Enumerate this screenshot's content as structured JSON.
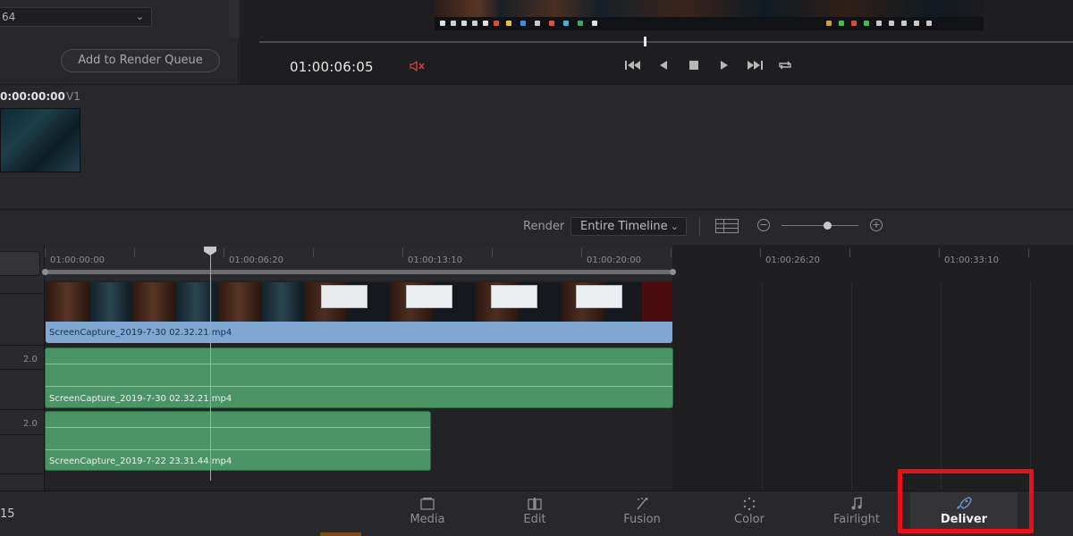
{
  "settings": {
    "codec_value": "64",
    "add_to_render_queue": "Add to Render Queue"
  },
  "viewer": {
    "timecode": "01:00:06:05",
    "muted": true
  },
  "clip": {
    "timecode": "0:00:00:00",
    "track": "V1"
  },
  "render_bar": {
    "label": "Render",
    "selected": "Entire Timeline"
  },
  "timeline": {
    "ruler": [
      "01:00:00:00",
      "01:00:06:20",
      "01:00:13:10",
      "01:00:20:00",
      "01:00:26:20",
      "01:00:33:10"
    ],
    "levels": [
      "2.0",
      "2.0"
    ],
    "video_clip": "ScreenCapture_2019-7-30 02.32.21.mp4",
    "audio_clip_1": "ScreenCapture_2019-7-30 02.32.21.mp4",
    "audio_clip_2": "ScreenCapture_2019-7-22 23.31.44.mp4"
  },
  "pages": {
    "count": "15",
    "items": [
      {
        "label": "Media",
        "icon": "media-icon",
        "active": false
      },
      {
        "label": "Edit",
        "icon": "edit-icon",
        "active": false
      },
      {
        "label": "Fusion",
        "icon": "fusion-icon",
        "active": false
      },
      {
        "label": "Color",
        "icon": "color-icon",
        "active": false
      },
      {
        "label": "Fairlight",
        "icon": "music-note-icon",
        "active": false
      },
      {
        "label": "Deliver",
        "icon": "rocket-icon",
        "active": true
      }
    ]
  },
  "colors": {
    "accent_blue": "#6a98d2",
    "video_clip": "#7fa7d1",
    "audio_clip": "#4a9466",
    "highlight_red": "#e8111b",
    "mute_red": "#d0453a"
  }
}
